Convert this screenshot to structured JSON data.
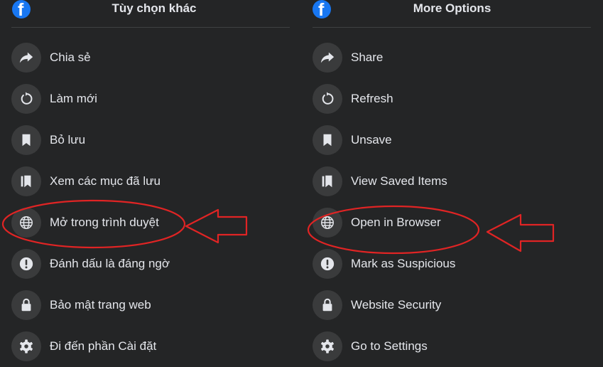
{
  "left_panel": {
    "title": "Tùy chọn khác",
    "items": [
      {
        "label": "Chia sẻ",
        "icon": "share-icon"
      },
      {
        "label": "Làm mới",
        "icon": "refresh-icon"
      },
      {
        "label": "Bỏ lưu",
        "icon": "bookmark-icon"
      },
      {
        "label": "Xem các mục đã lưu",
        "icon": "saved-items-icon"
      },
      {
        "label": "Mở trong trình duyệt",
        "icon": "globe-icon"
      },
      {
        "label": "Đánh dấu là đáng ngờ",
        "icon": "alert-icon"
      },
      {
        "label": "Bảo mật trang web",
        "icon": "lock-icon"
      },
      {
        "label": "Đi đến phần Cài đặt",
        "icon": "gear-icon"
      }
    ]
  },
  "right_panel": {
    "title": "More Options",
    "items": [
      {
        "label": "Share",
        "icon": "share-icon"
      },
      {
        "label": "Refresh",
        "icon": "refresh-icon"
      },
      {
        "label": "Unsave",
        "icon": "bookmark-icon"
      },
      {
        "label": "View Saved Items",
        "icon": "saved-items-icon"
      },
      {
        "label": "Open in Browser",
        "icon": "globe-icon"
      },
      {
        "label": "Mark as Suspicious",
        "icon": "alert-icon"
      },
      {
        "label": "Website Security",
        "icon": "lock-icon"
      },
      {
        "label": "Go to Settings",
        "icon": "gear-icon"
      }
    ]
  },
  "colors": {
    "background": "#242526",
    "icon_circle": "#3a3b3c",
    "text": "#e4e6eb",
    "facebook_blue": "#1877f2",
    "annotation_red": "#e02424"
  }
}
